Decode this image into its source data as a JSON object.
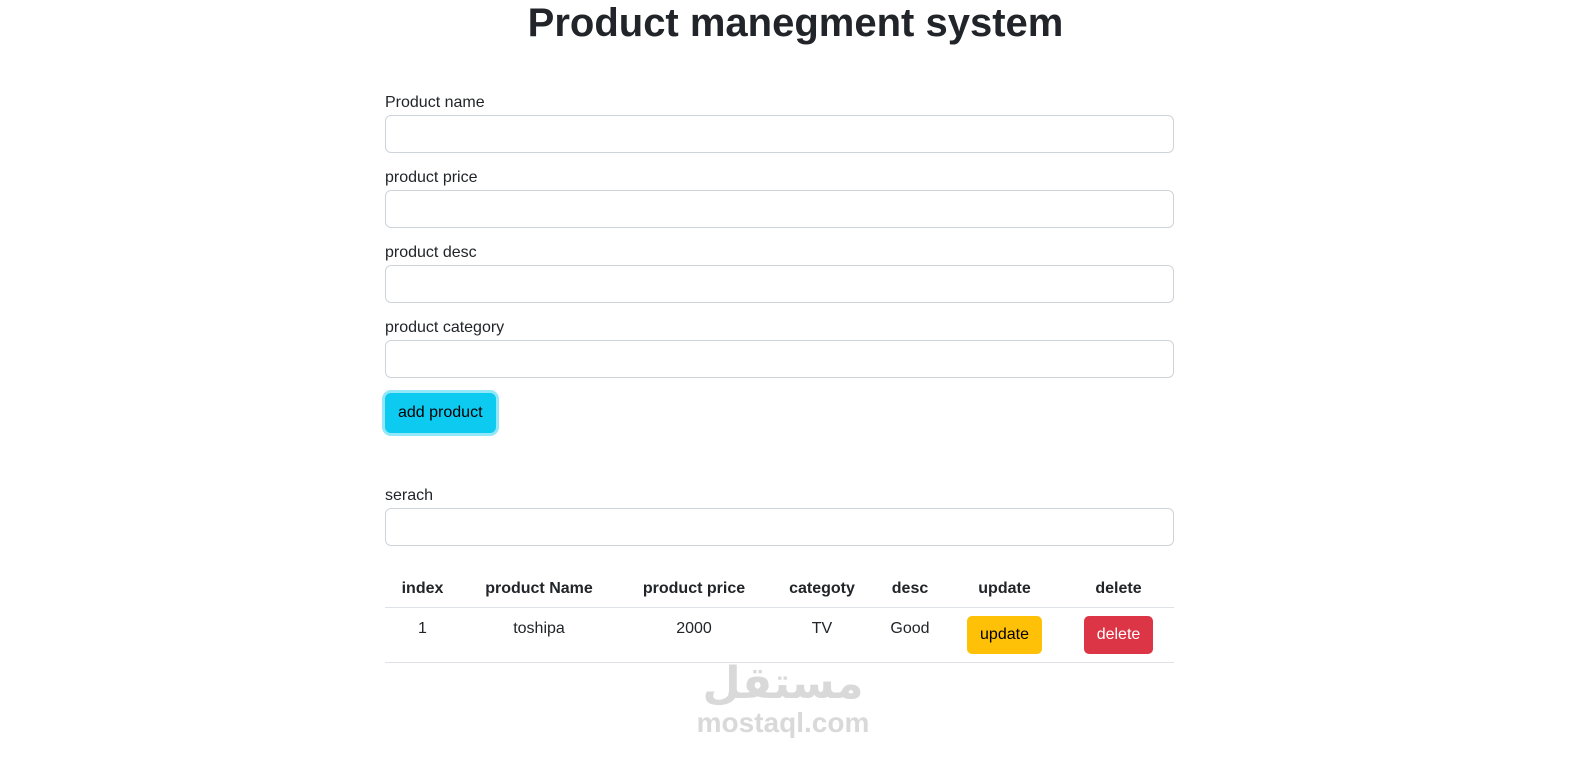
{
  "header": {
    "title": "Product manegment system"
  },
  "form": {
    "fields": [
      {
        "label": "Product name",
        "value": "",
        "placeholder": ""
      },
      {
        "label": "product price",
        "value": "",
        "placeholder": ""
      },
      {
        "label": "product desc",
        "value": "",
        "placeholder": ""
      },
      {
        "label": "product category",
        "value": "",
        "placeholder": ""
      }
    ],
    "add_label": "add product"
  },
  "search": {
    "label": "serach",
    "value": "",
    "placeholder": ""
  },
  "table": {
    "headers": [
      "index",
      "product Name",
      "product price",
      "categoty",
      "desc",
      "update",
      "delete"
    ],
    "rows": [
      {
        "index": "1",
        "name": "toshipa",
        "price": "2000",
        "category": "TV",
        "desc": "Good",
        "update_label": "update",
        "delete_label": "delete"
      }
    ]
  },
  "watermark": {
    "arabic": "مستقل",
    "latin": "mostaql.com"
  },
  "colors": {
    "info": "#0dcaf0",
    "warning": "#ffc107",
    "danger": "#dc3545",
    "text": "#212529",
    "border": "#ced4da"
  }
}
